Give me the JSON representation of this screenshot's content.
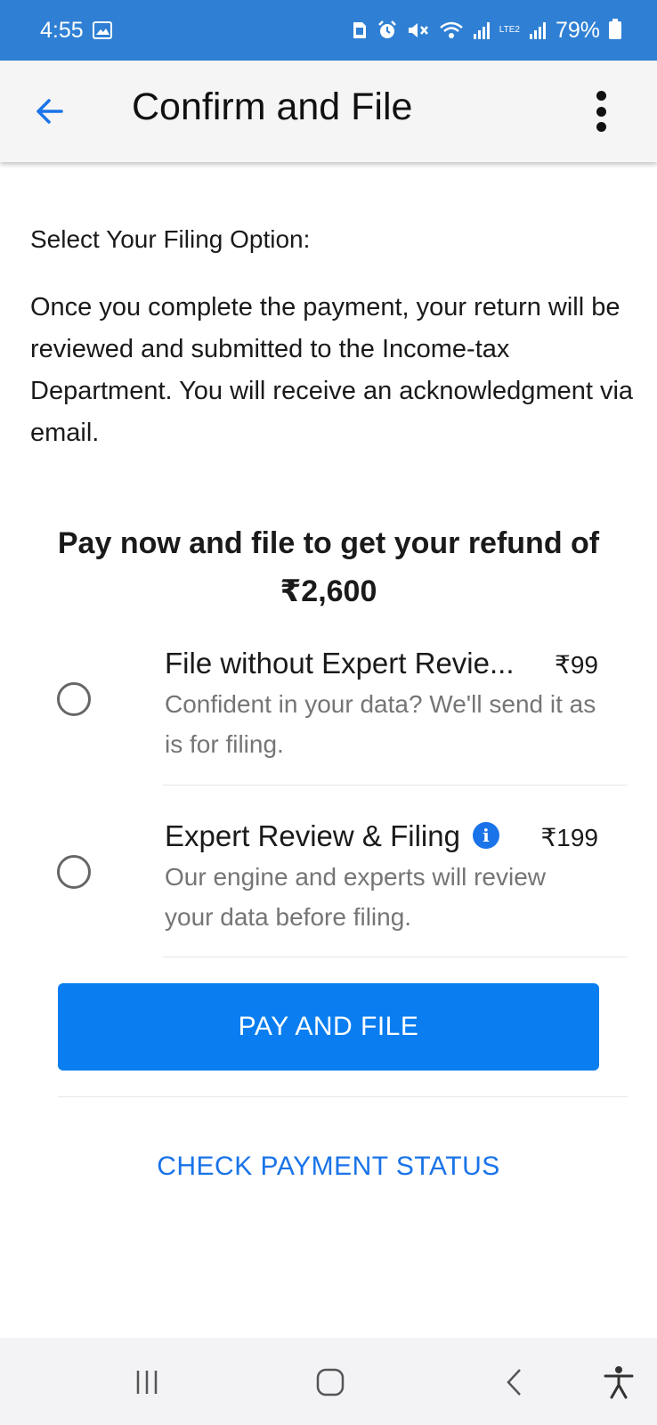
{
  "status_bar": {
    "time": "4:55",
    "battery": "79%",
    "network_label": "LTE2",
    "icons": [
      "gallery-icon",
      "sim-icon",
      "alarm-icon",
      "mute-icon",
      "wifi-icon",
      "signal-icon",
      "battery-icon"
    ]
  },
  "app_bar": {
    "title": "Confirm and File",
    "back_icon": "arrow-left-icon",
    "menu_icon": "more-vertical-icon"
  },
  "content": {
    "select_label": "Select Your Filing Option:",
    "info": "Once you complete the payment, your return will be reviewed and submitted to the Income-tax Department. You will receive an acknowledgment via email.",
    "refund_line1": "Pay now and file to get your refund of",
    "refund_amount": "₹2,600"
  },
  "options": [
    {
      "title": "File without Expert Revie...",
      "price": "₹99",
      "description": "Confident in your data? We'll send it as is for filing.",
      "selected": false
    },
    {
      "title": "Expert Review & Filing",
      "price": "₹199",
      "description": "Our engine and experts will review your data before filing.",
      "info_icon": "i",
      "selected": false
    }
  ],
  "actions": {
    "pay_button": "PAY AND FILE",
    "check_status": "CHECK PAYMENT STATUS"
  },
  "nav_bar": {
    "items": [
      "recents-icon",
      "home-icon",
      "back-icon",
      "accessibility-icon"
    ]
  },
  "colors": {
    "status_bar": "#2f80d4",
    "primary": "#0a7ef0",
    "link": "#1a73e8"
  }
}
